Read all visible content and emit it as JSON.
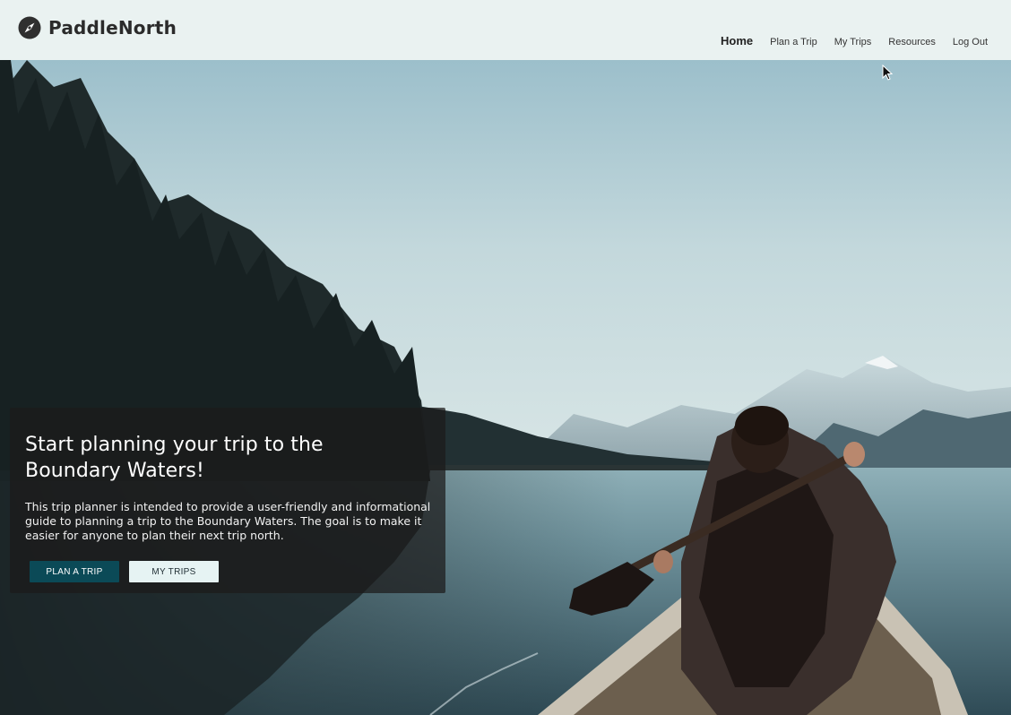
{
  "brand": {
    "name": "PaddleNorth",
    "icon": "compass-icon"
  },
  "nav": {
    "items": [
      {
        "label": "Home",
        "active": true
      },
      {
        "label": "Plan a Trip",
        "active": false
      },
      {
        "label": "My Trips",
        "active": false
      },
      {
        "label": "Resources",
        "active": false
      },
      {
        "label": "Log Out",
        "active": false
      }
    ]
  },
  "hero": {
    "title": "Start planning your trip to the Boundary Waters!",
    "description": "This trip planner is intended to provide a user-friendly and informational guide to planning a trip to the Boundary Waters. The goal is to make it easier for anyone to plan their next trip north.",
    "primary_button": "PLAN A TRIP",
    "secondary_button": "MY TRIPS"
  },
  "colors": {
    "header_bg": "#eaf2f1",
    "primary_button_bg": "#0b4a57",
    "secondary_button_bg": "#e6f3f3",
    "card_bg": "#1c1a1a"
  }
}
